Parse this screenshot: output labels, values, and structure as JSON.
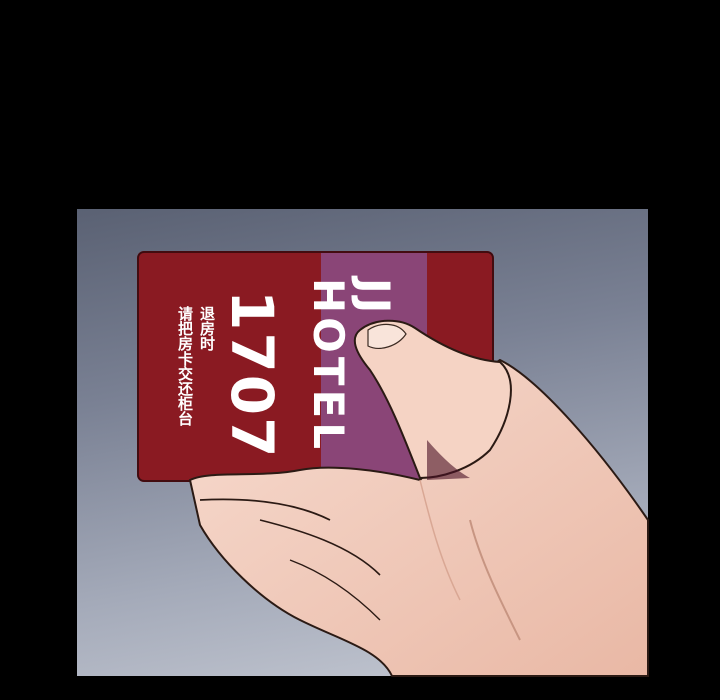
{
  "card": {
    "room_number": "1707",
    "return_notice_line1": "退房时",
    "return_notice_line2": "请把房卡交还柜台",
    "brand": "JJ HOTEL"
  },
  "colors": {
    "card_red": "#8a1a22",
    "card_stripe": "#8a4577",
    "skin": "#f3cdbd",
    "background": "#000000"
  }
}
